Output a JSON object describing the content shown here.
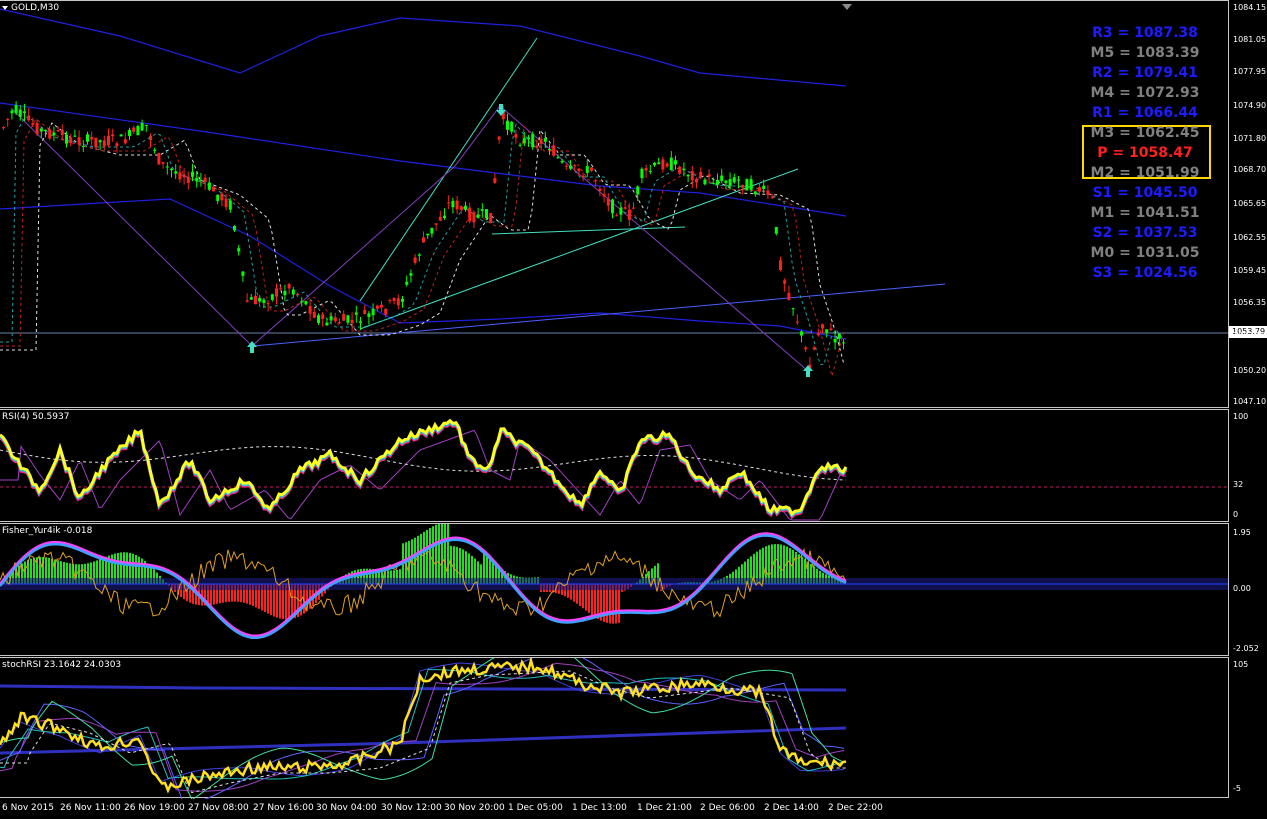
{
  "main": {
    "label": "GOLD,M30",
    "dropdown_icon": "chevron-down-icon",
    "current_price": "1053.79",
    "ticks": [
      "1084.15",
      "1081.05",
      "1077.95",
      "1074.90",
      "1071.80",
      "1068.70",
      "1065.65",
      "1062.55",
      "1059.45",
      "1056.35",
      "1053.30",
      "1050.20",
      "1047.10"
    ]
  },
  "pivots": [
    {
      "text": "R3 = 1087.38",
      "color": "#1c1cff"
    },
    {
      "text": "M5 = 1083.39",
      "color": "#808080"
    },
    {
      "text": "R2 = 1079.41",
      "color": "#1c1cff"
    },
    {
      "text": "M4 = 1072.93",
      "color": "#808080"
    },
    {
      "text": "R1 = 1066.44",
      "color": "#1c1cff"
    },
    {
      "text": "M3 = 1062.45",
      "color": "#808080"
    },
    {
      "text": "P  = 1058.47",
      "color": "#ff2020"
    },
    {
      "text": "M2 = 1051.99",
      "color": "#808080"
    },
    {
      "text": "S1 = 1045.50",
      "color": "#1c1cff"
    },
    {
      "text": "M1 = 1041.51",
      "color": "#808080"
    },
    {
      "text": "S2 = 1037.53",
      "color": "#1c1cff"
    },
    {
      "text": "M0 = 1031.05",
      "color": "#808080"
    },
    {
      "text": "S3 = 1024.56",
      "color": "#1c1cff"
    }
  ],
  "rsi": {
    "label": "RSI(4) 50.5937",
    "ticks": [
      "100",
      "32",
      "0"
    ]
  },
  "fisher": {
    "label": "Fisher_Yur4ik -0.018",
    "ticks": [
      "1.95",
      "0.00",
      "-2.052"
    ]
  },
  "stoch": {
    "label": "stochRSI 23.1642 24.0303",
    "ticks": [
      "105",
      "-5"
    ]
  },
  "time_axis": [
    "6 Nov 2015",
    "26 Nov 11:00",
    "26 Nov 19:00",
    "27 Nov 08:00",
    "27 Nov 16:00",
    "30 Nov 04:00",
    "30 Nov 12:00",
    "30 Nov 20:00",
    "1 Dec 05:00",
    "1 Dec 13:00",
    "1 Dec 21:00",
    "2 Dec 06:00",
    "2 Dec 14:00",
    "2 Dec 22:00"
  ],
  "colors": {
    "bull": "#00ff00",
    "bear": "#ff2020",
    "channel": "#2020ff",
    "trend": "#40e0c0",
    "highlight": "#ffd800"
  }
}
